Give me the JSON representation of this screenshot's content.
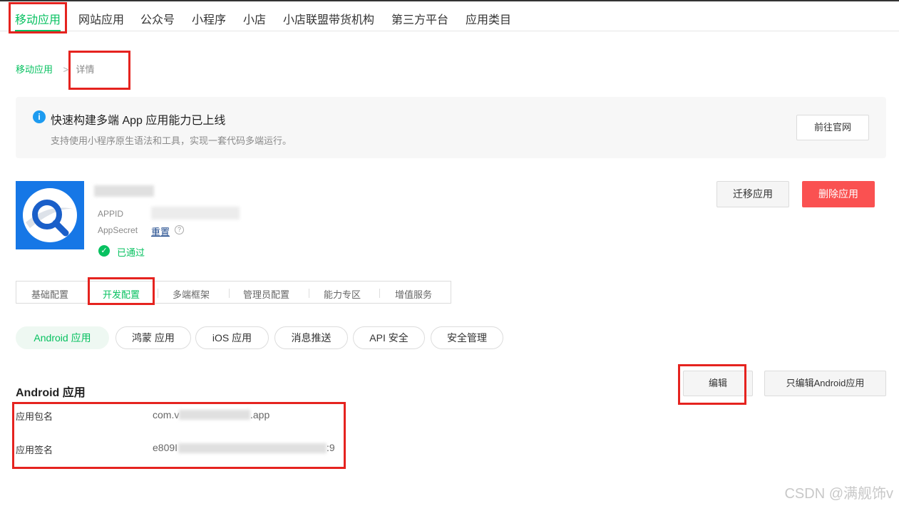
{
  "top_nav": {
    "items": [
      "移动应用",
      "网站应用",
      "公众号",
      "小程序",
      "小店",
      "小店联盟带货机构",
      "第三方平台",
      "应用类目"
    ]
  },
  "breadcrumb": {
    "parent": "移动应用",
    "separator": ">",
    "current": "详情"
  },
  "banner": {
    "icon": "i",
    "title": "快速构建多端 App 应用能力已上线",
    "subtitle": "支持使用小程序原生语法和工具，实现一套代码多端运行。",
    "button": "前往官网"
  },
  "app": {
    "appid_label": "APPID",
    "appsecret_label": "AppSecret",
    "reset_link": "重置",
    "help_icon": "?",
    "status_icon": "✓",
    "status": "已通过",
    "migrate_button": "迁移应用",
    "delete_button": "删除应用"
  },
  "tabs": [
    "基础配置",
    "开发配置",
    "多端框架",
    "管理员配置",
    "能力专区",
    "增值服务"
  ],
  "platform_tabs": [
    "Android 应用",
    "鸿蒙 应用",
    "iOS 应用",
    "消息推送",
    "API 安全",
    "安全管理"
  ],
  "section": {
    "title": "Android 应用",
    "edit_button": "编辑",
    "edit_android_button": "只编辑Android应用",
    "rows": [
      {
        "label": "应用包名",
        "value_start": "com.v",
        "value_end": ".app"
      },
      {
        "label": "应用签名",
        "value_start": "e809I",
        "value_end": ":9"
      }
    ]
  },
  "watermark": "CSDN @满舰饰v",
  "colors": {
    "accent": "#07c160",
    "danger": "#fa5151",
    "annotation": "#e5231f",
    "info": "#1d9bf0",
    "logo_bg": "#1677e6"
  }
}
